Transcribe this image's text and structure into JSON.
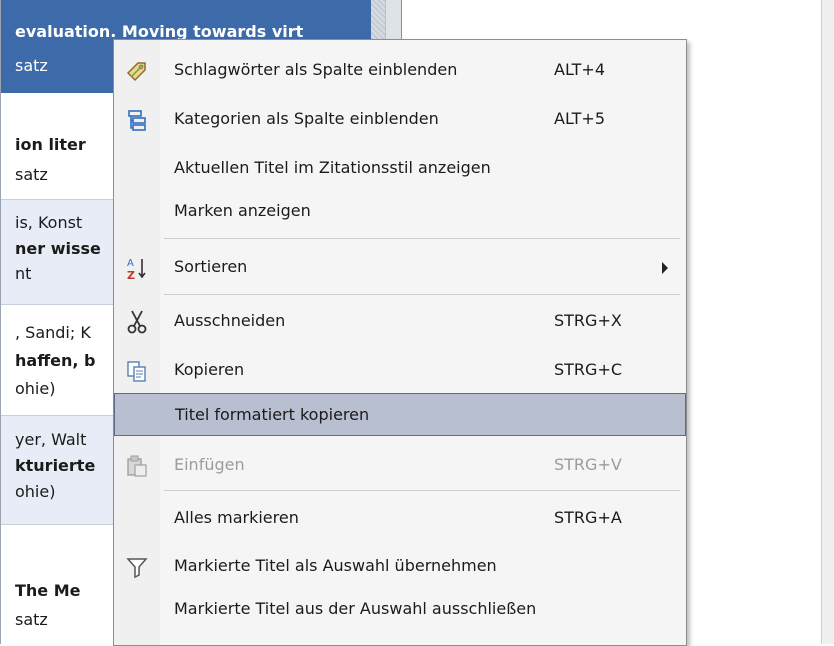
{
  "list": {
    "rows": [
      {
        "l1": "evaluation. Moving towards virt",
        "l2": "satz"
      },
      {
        "l1": "ion liter",
        "l2": "satz"
      },
      {
        "l0": "is, Konst",
        "l1": "ner wisse",
        "l2": "nt"
      },
      {
        "l0": ", Sandi; K",
        "l1": "haffen, b",
        "l2": "ohie)"
      },
      {
        "l0": "yer, Walt",
        "l1": "kturierte",
        "l2": "ohie)"
      },
      {
        "l1": "The Me",
        "l2": "satz"
      }
    ]
  },
  "menu": {
    "items": [
      {
        "label": "Schlagwörter als Spalte einblenden",
        "shortcut": "ALT+4",
        "icon": "tag-icon"
      },
      {
        "label": "Kategorien als Spalte einblenden",
        "shortcut": "ALT+5",
        "icon": "category-tree-icon"
      },
      {
        "label": "Aktuellen Titel im Zitationsstil anzeigen",
        "shortcut": ""
      },
      {
        "label": "Marken anzeigen",
        "shortcut": ""
      },
      {
        "label": "Sortieren",
        "shortcut": "",
        "icon": "sort-az-icon",
        "submenu": true
      },
      {
        "label": "Ausschneiden",
        "shortcut": "STRG+X",
        "icon": "scissors-icon"
      },
      {
        "label": "Kopieren",
        "shortcut": "STRG+C",
        "icon": "copy-icon"
      },
      {
        "label": "Titel formatiert kopieren",
        "shortcut": "",
        "highlighted": true
      },
      {
        "label": "Einfügen",
        "shortcut": "STRG+V",
        "icon": "paste-icon",
        "disabled": true
      },
      {
        "label": "Alles markieren",
        "shortcut": "STRG+A"
      },
      {
        "label": "Markierte Titel als Auswahl übernehmen",
        "shortcut": "",
        "icon": "filter-icon"
      },
      {
        "label": "Markierte Titel aus der Auswahl ausschließen",
        "shortcut": ""
      }
    ]
  },
  "colors": {
    "selection": "#3d6aa8",
    "highlight": "#b8bfd1",
    "menu_bg": "#f5f5f5"
  }
}
